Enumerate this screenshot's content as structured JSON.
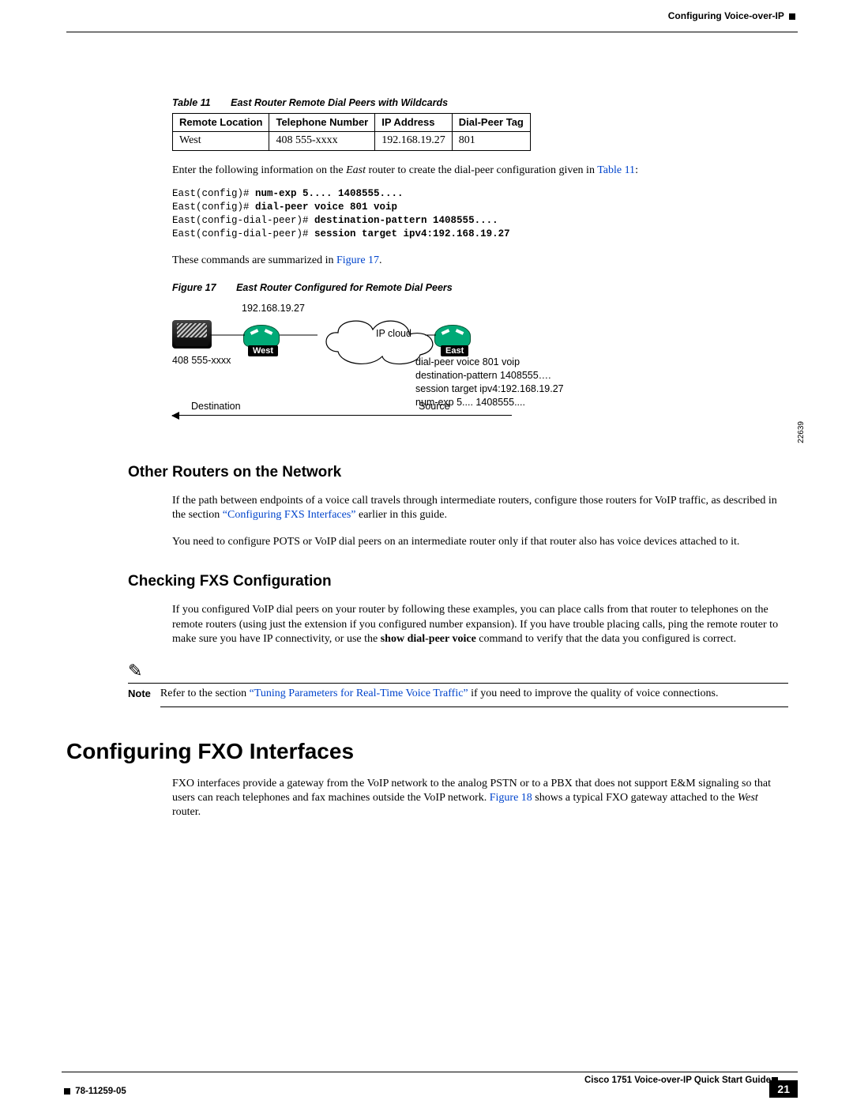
{
  "header": {
    "running_title": "Configuring Voice-over-IP"
  },
  "table11": {
    "caption_num": "Table 11",
    "caption_text": "East Router Remote Dial Peers with Wildcards",
    "headers": [
      "Remote Location",
      "Telephone Number",
      "IP Address",
      "Dial-Peer Tag"
    ],
    "row": {
      "loc": "West",
      "tel": "408 555-xxxx",
      "ip": "192.168.19.27",
      "tag": "801"
    }
  },
  "para1": {
    "lead": "Enter the following information on the ",
    "em": "East",
    "mid": " router to create the dial-peer configuration given in ",
    "link": "Table 11",
    "tail": ":"
  },
  "code1": {
    "l1p": "East(config)# ",
    "l1c": "num-exp 5.... 1408555....",
    "l2p": "East(config)# ",
    "l2c": "dial-peer voice 801 voip",
    "l3p": "East(config-dial-peer)# ",
    "l3c": "destination-pattern 1408555....",
    "l4p": "East(config-dial-peer)# ",
    "l4c": "session target ipv4:192.168.19.27"
  },
  "para2": {
    "lead": "These commands are summarized in ",
    "link": "Figure 17",
    "tail": "."
  },
  "figure17": {
    "caption_num": "Figure 17",
    "caption_text": "East Router Configured for Remote Dial Peers",
    "ip": "192.168.19.27",
    "tel": "408 555-xxxx",
    "cloud": "IP cloud",
    "west": "West",
    "east": "East",
    "cfg1": "dial-peer voice 801 voip",
    "cfg2": "destination-pattern 1408555….",
    "cfg3": "session target ipv4:192.168.19.27",
    "cfg4": "num-exp 5.... 1408555....",
    "dest": "Destination",
    "src": "Source",
    "jobnum": "22639"
  },
  "sec_other": {
    "title": "Other Routers on the Network",
    "p1a": "If the path between endpoints of a voice call travels through intermediate routers, configure those routers for VoIP traffic, as described in the section ",
    "p1link": "“Configuring FXS Interfaces”",
    "p1b": " earlier in this guide.",
    "p2": "You need to configure POTS or VoIP dial peers on an intermediate router only if that router also has voice devices attached to it."
  },
  "sec_check": {
    "title": "Checking FXS Configuration",
    "p1a": "If you configured VoIP dial peers on your router by following these examples, you can place calls from that router to telephones on the remote routers (using just the extension if you configured number expansion). If you have trouble placing calls, ping the remote router to make sure you have IP connectivity, or use the ",
    "p1b": "show dial-peer voice",
    "p1c": " command to verify that the data you configured is correct."
  },
  "note": {
    "label": "Note",
    "a": "Refer to the section ",
    "link": "“Tuning Parameters for Real-Time Voice Traffic”",
    "b": " if you need to improve the quality of voice connections."
  },
  "sec_fxo": {
    "title": "Configuring FXO Interfaces",
    "p1a": "FXO interfaces provide a gateway from the VoIP network to the analog PSTN or to a PBX that does not support E&M signaling so that users can reach telephones and fax machines outside the VoIP network. ",
    "p1link": "Figure 18",
    "p1b": " shows a typical FXO gateway attached to the ",
    "p1em": "West",
    "p1c": " router."
  },
  "footer": {
    "right_title": "Cisco 1751 Voice-over-IP Quick Start Guide",
    "left_code": "78-11259-05",
    "page": "21"
  }
}
